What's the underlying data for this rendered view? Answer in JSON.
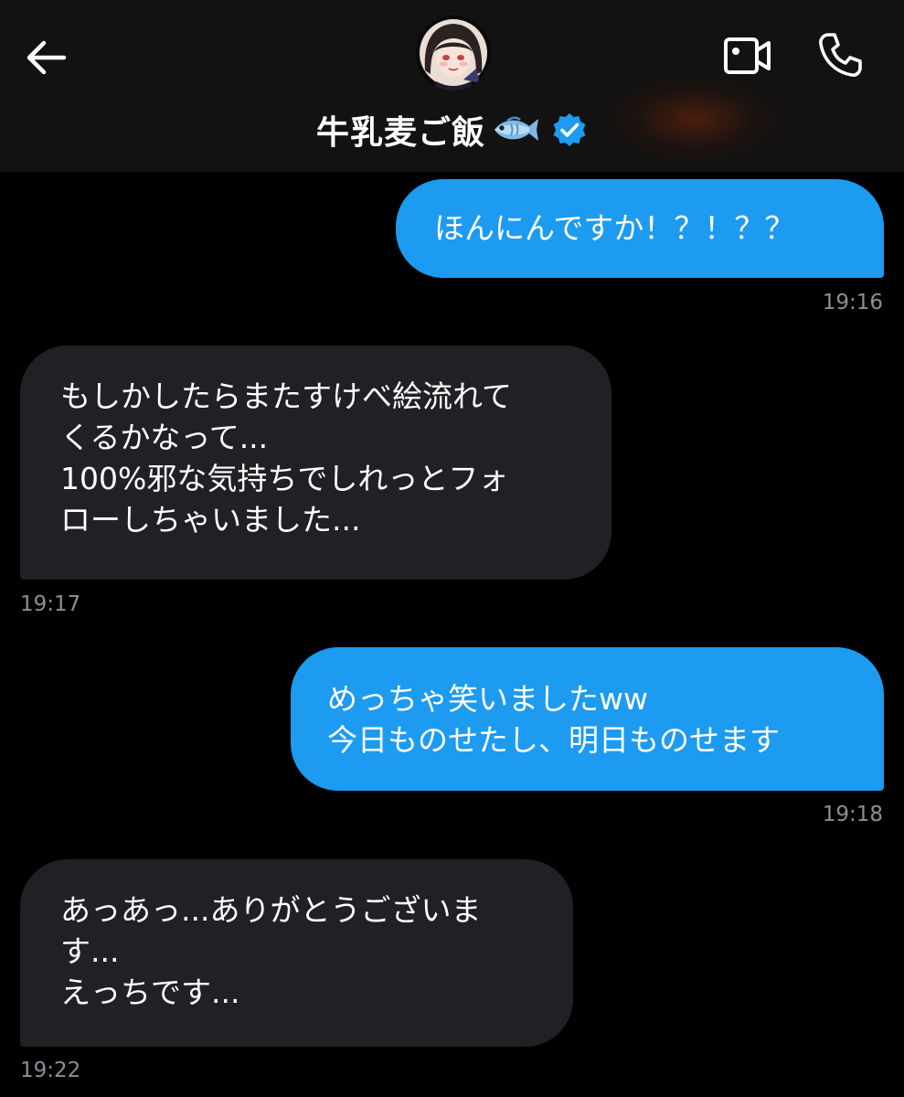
{
  "header": {
    "contact_name": "牛乳麦ご飯",
    "name_emoji": "fish-emoji",
    "verified": true,
    "icons": {
      "back": "arrow-left-icon",
      "video": "video-camera-icon",
      "call": "phone-icon",
      "verified": "verified-badge-icon"
    }
  },
  "colors": {
    "background": "#000000",
    "header_background": "#121212",
    "sent_bubble": "#1d9bf0",
    "received_bubble": "#1f2125",
    "timestamp": "#8b9096",
    "verified_badge": "#1d9bf0"
  },
  "messages": [
    {
      "direction": "sent",
      "text": "ほんにんですか！？！？？",
      "time": "19:16"
    },
    {
      "direction": "received",
      "text": "もしかしたらまたすけべ絵流れて\nくるかなって...\n100%邪な気持ちでしれっとフォ\nローしちゃいました...",
      "time": "19:17"
    },
    {
      "direction": "sent",
      "text": "めっちゃ笑いましたww\n今日ものせたし、明日ものせます",
      "time": "19:18"
    },
    {
      "direction": "received",
      "text": "あっあっ...ありがとうございま\nす...\nえっちです...",
      "time": "19:22"
    }
  ]
}
